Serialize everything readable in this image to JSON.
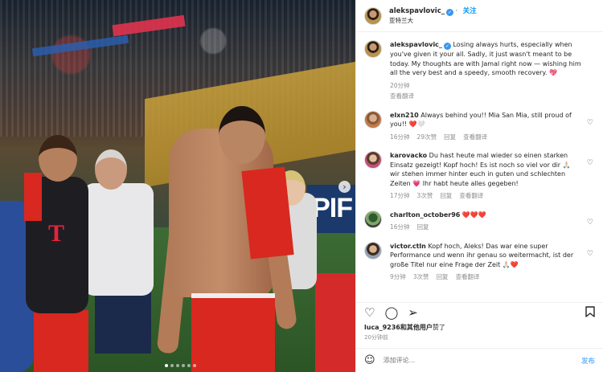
{
  "post": {
    "username": "alekspavlovic_",
    "follow_label": "关注",
    "location": "亚特兰大",
    "photo_sign_text": "PIF"
  },
  "comments": [
    {
      "username": "alekspavlovic_",
      "verified": true,
      "text": "Losing always hurts, especially when you've given it your all. Sadly, it just wasn't meant to be today. My thoughts are with Jamal right now — wishing him all the very best and a speedy, smooth recovery. 💖",
      "time": "20分钟",
      "likes": "",
      "reply_label": "",
      "translate_label": "查看翻译"
    },
    {
      "username": "elxn210",
      "text": "Always behind you!! Mia San Mia, still proud of you!! ❤️🤍",
      "time": "16分钟",
      "likes": "29次赞",
      "reply_label": "回复",
      "translate_label": "查看翻译"
    },
    {
      "username": "karovacko",
      "text": "Du hast heute mal wieder so einen starken Einsatz gezeigt! Kopf hoch! Es ist noch so viel vor dir 🙏🏻 wir stehen immer hinter euch in guten und schlechten Zeiten 💗 Ihr habt heute alles gegeben!",
      "time": "17分钟",
      "likes": "3次赞",
      "reply_label": "回复",
      "translate_label": "查看翻译"
    },
    {
      "username": "charlton_october96",
      "text": "❤️❤️❤️",
      "time": "16分钟",
      "likes": "",
      "reply_label": "回复",
      "translate_label": ""
    },
    {
      "username": "victor.ctln",
      "text": "Kopf hoch, Aleks! Das war eine super Performance und wenn ihr genau so weitermacht, ist der große Titel nur eine Frage der Zeit 🙏🏻❤️",
      "time": "9分钟",
      "likes": "3次赞",
      "reply_label": "回复",
      "translate_label": "查看翻译"
    }
  ],
  "likes_line": {
    "user": "luca_9236",
    "suffix_bold": "和其他用户",
    "suffix": "赞了"
  },
  "post_time": "20分钟前",
  "add_comment": {
    "placeholder": "添加评论...",
    "post_label": "发布"
  },
  "icons": {
    "like": "heart-icon",
    "comment": "comment-icon",
    "share": "send-icon",
    "save": "bookmark-icon",
    "emoji": "emoji-icon",
    "next": "chevron-right-icon"
  },
  "colors": {
    "link": "#0095f6",
    "verified": "#3897f0",
    "muted": "#8e8e8e"
  }
}
